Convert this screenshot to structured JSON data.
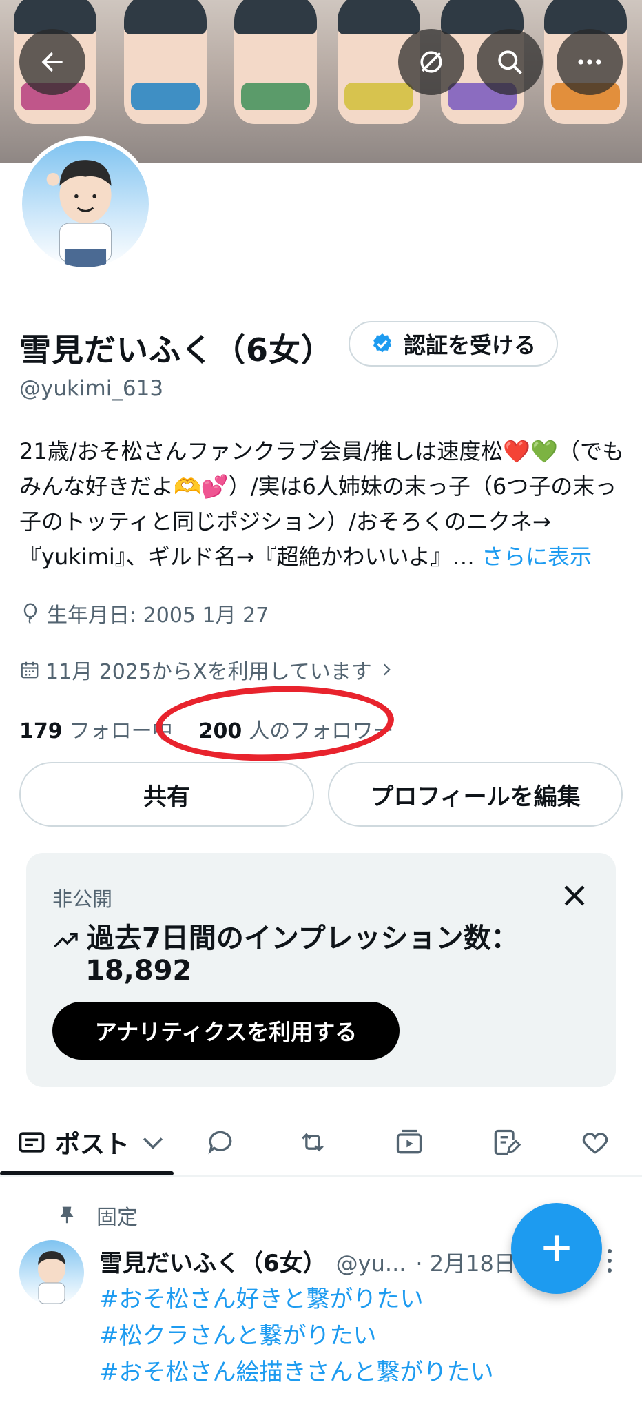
{
  "header": {
    "back_icon": "arrow-left-icon",
    "grok_icon": "slash-circle-icon",
    "search_icon": "search-icon",
    "more_icon": "more-horizontal-icon"
  },
  "profile": {
    "name": "雪見だいふく（6女）",
    "handle": "@yukimi_613",
    "verify_label": "認証を受ける",
    "bio_text": "21歳/おそ松さんファンクラブ会員/推しは速度松❤️💚（でもみんな好きだよ🫶💕）/実は6人姉妹の末っ子（6つ子の末っ子のトッティと同じポジション）/おそろくのニクネ→『yukimi』、ギルド名→『超絶かわいいよ』… ",
    "bio_more": "さらに表示",
    "birthday": "生年月日: 2005 1月 27",
    "joined": "11月 2025からXを利用しています",
    "following_count": "179",
    "following_label": "フォロー中",
    "followers_count": "200",
    "followers_label": "人のフォロワー",
    "share_label": "共有",
    "edit_label": "プロフィールを編集"
  },
  "analytics_card": {
    "private_label": "非公開",
    "impressions_label": "過去7日間のインプレッション数：",
    "impressions_value": "18,892",
    "cta_label": "アナリティクスを利用する"
  },
  "tabs": {
    "posts_label": "ポスト"
  },
  "pinned_post": {
    "pinned_label": "固定",
    "author_name": "雪見だいふく（6女）",
    "author_handle": "@yu...",
    "date": "· 2月18日",
    "lines": [
      "#おそ松さん好きと繋がりたい",
      "#松クラさんと繋がりたい",
      "#おそ松さん絵描きさんと繋がりたい"
    ]
  },
  "colors": {
    "accent": "#1d9bf0",
    "annotation_circle": "#e8232d",
    "text_secondary": "#536471"
  }
}
